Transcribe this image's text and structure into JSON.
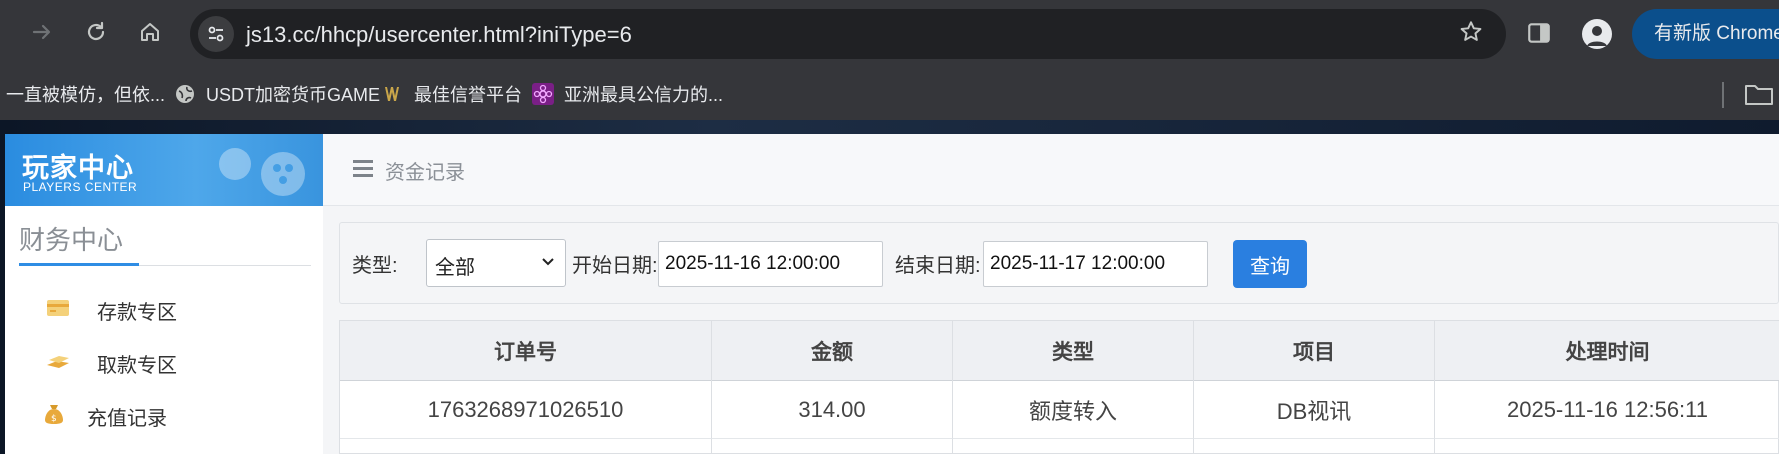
{
  "browser": {
    "url": "js13.cc/hhcp/usercenter.html?iniType=6",
    "update_label": "有新版 Chrome",
    "bookmarks": [
      {
        "label": "一直被模仿，但依..."
      },
      {
        "label": "USDT加密货币GAME"
      },
      {
        "label": "最佳信誉平台"
      },
      {
        "label": "亚洲最具公信力的..."
      }
    ]
  },
  "sidebar": {
    "title": "玩家中心",
    "subtitle": "PLAYERS CENTER",
    "section_title": "财务中心",
    "items": [
      {
        "label": "存款专区",
        "icon": "card-icon"
      },
      {
        "label": "取款专区",
        "icon": "cash-icon"
      },
      {
        "label": "充值记录",
        "icon": "money-bag-icon"
      }
    ]
  },
  "main": {
    "breadcrumb": "资金记录",
    "filter": {
      "type_label": "类型:",
      "type_value": "全部",
      "start_label": "开始日期:",
      "start_value": "2025-11-16 12:00:00",
      "end_label": "结束日期:",
      "end_value": "2025-11-17 12:00:00",
      "query_label": "查询"
    },
    "table": {
      "headers": [
        "订单号",
        "金额",
        "类型",
        "项目",
        "处理时间"
      ],
      "rows": [
        [
          "1763268971026510",
          "314.00",
          "额度转入",
          "DB视讯",
          "2025-11-16 12:56:11"
        ]
      ]
    }
  },
  "colors": {
    "accent": "#2a7fe0",
    "sidebar_header": "#2a8ce0",
    "browser_bar": "#35363a"
  }
}
